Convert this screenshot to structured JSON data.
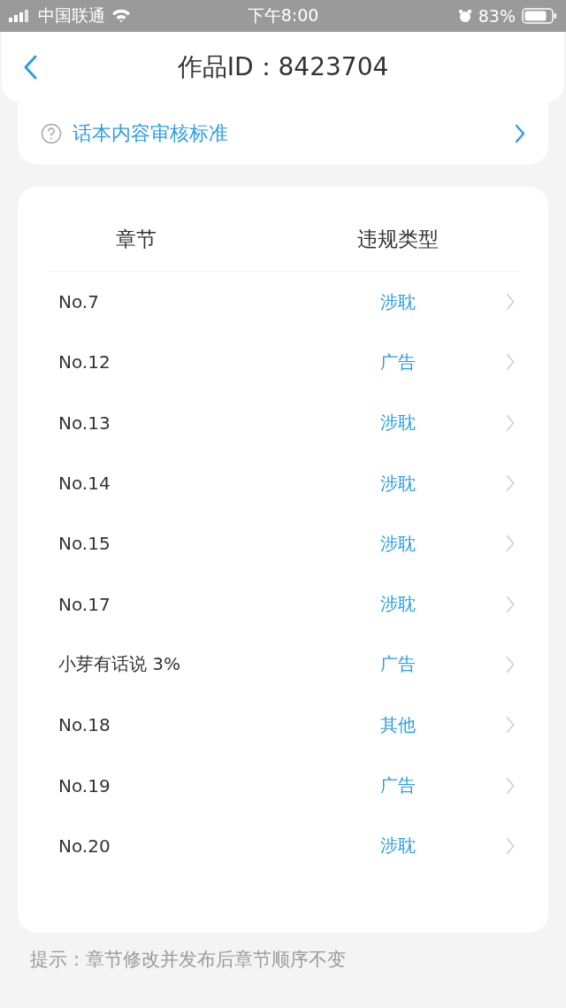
{
  "status_bar": {
    "carrier": "中国联通",
    "time": "下午8:00",
    "battery": "83%"
  },
  "nav": {
    "title": "作品ID：8423704"
  },
  "guide_link": {
    "label": "话本内容审核标准"
  },
  "table": {
    "columns": [
      "章节",
      "违规类型"
    ],
    "rows": [
      {
        "chapter": "No.7",
        "violation": "涉耽"
      },
      {
        "chapter": "No.12",
        "violation": "广告"
      },
      {
        "chapter": "No.13",
        "violation": "涉耽"
      },
      {
        "chapter": "No.14",
        "violation": "涉耽"
      },
      {
        "chapter": "No.15",
        "violation": "涉耽"
      },
      {
        "chapter": "No.17",
        "violation": "涉耽"
      },
      {
        "chapter": "小芽有话说 3%",
        "violation": "广告"
      },
      {
        "chapter": "No.18",
        "violation": "其他"
      },
      {
        "chapter": "No.19",
        "violation": "广告"
      },
      {
        "chapter": "No.20",
        "violation": "涉耽"
      }
    ]
  },
  "hint": "提示：章节修改并发布后章节顺序不变"
}
